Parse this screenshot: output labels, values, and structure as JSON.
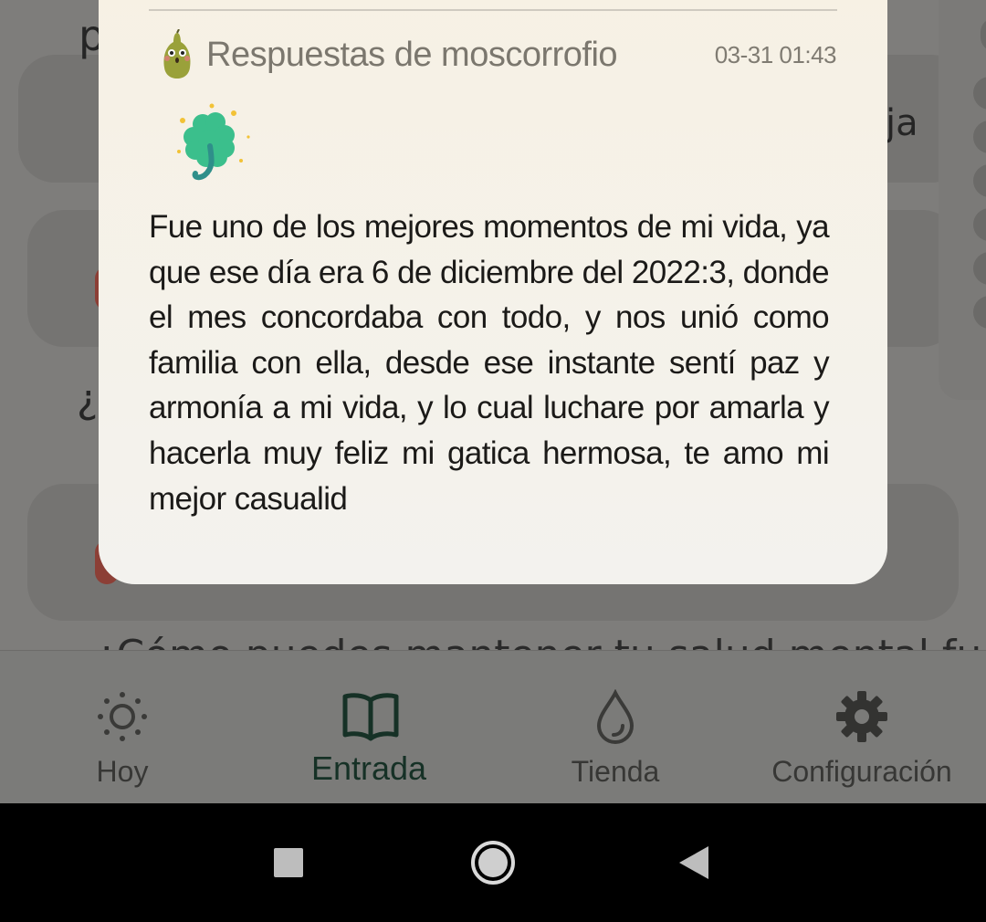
{
  "background": {
    "partial_texts": [
      "p",
      "ja",
      "¿",
      "¿Cómo puedes mantener tu salud mental fuerte?"
    ]
  },
  "reply": {
    "title": "Respuestas de moscorrofio",
    "timestamp": "03-31 01:43",
    "avatar_icon": "pear-character-icon",
    "sticker_icon": "four-leaf-clover-icon",
    "body": "Fue uno de los mejores momentos de mi vida, ya que ese día era 6 de diciembre del 2022:3, donde el mes concordaba con todo, y nos unió como familia con ella, desde ese instante sentí paz y armonía a mi vida, y lo cual luchare por amarla y hacerla muy feliz mi gatica hermosa, te amo mi mejor casualid"
  },
  "nav": {
    "items": [
      {
        "label": "Hoy",
        "icon": "sun-icon"
      },
      {
        "label": "Entrada",
        "icon": "book-icon",
        "active": true
      },
      {
        "label": "Tienda",
        "icon": "drop-icon"
      },
      {
        "label": "Configuración",
        "icon": "gear-icon"
      }
    ]
  },
  "system_bar": {
    "buttons": [
      "recents-button",
      "home-button",
      "back-button"
    ]
  },
  "colors": {
    "accent": "#163126",
    "modal_bg": "#f5f2ea",
    "scrim": "#7e7d7b"
  }
}
